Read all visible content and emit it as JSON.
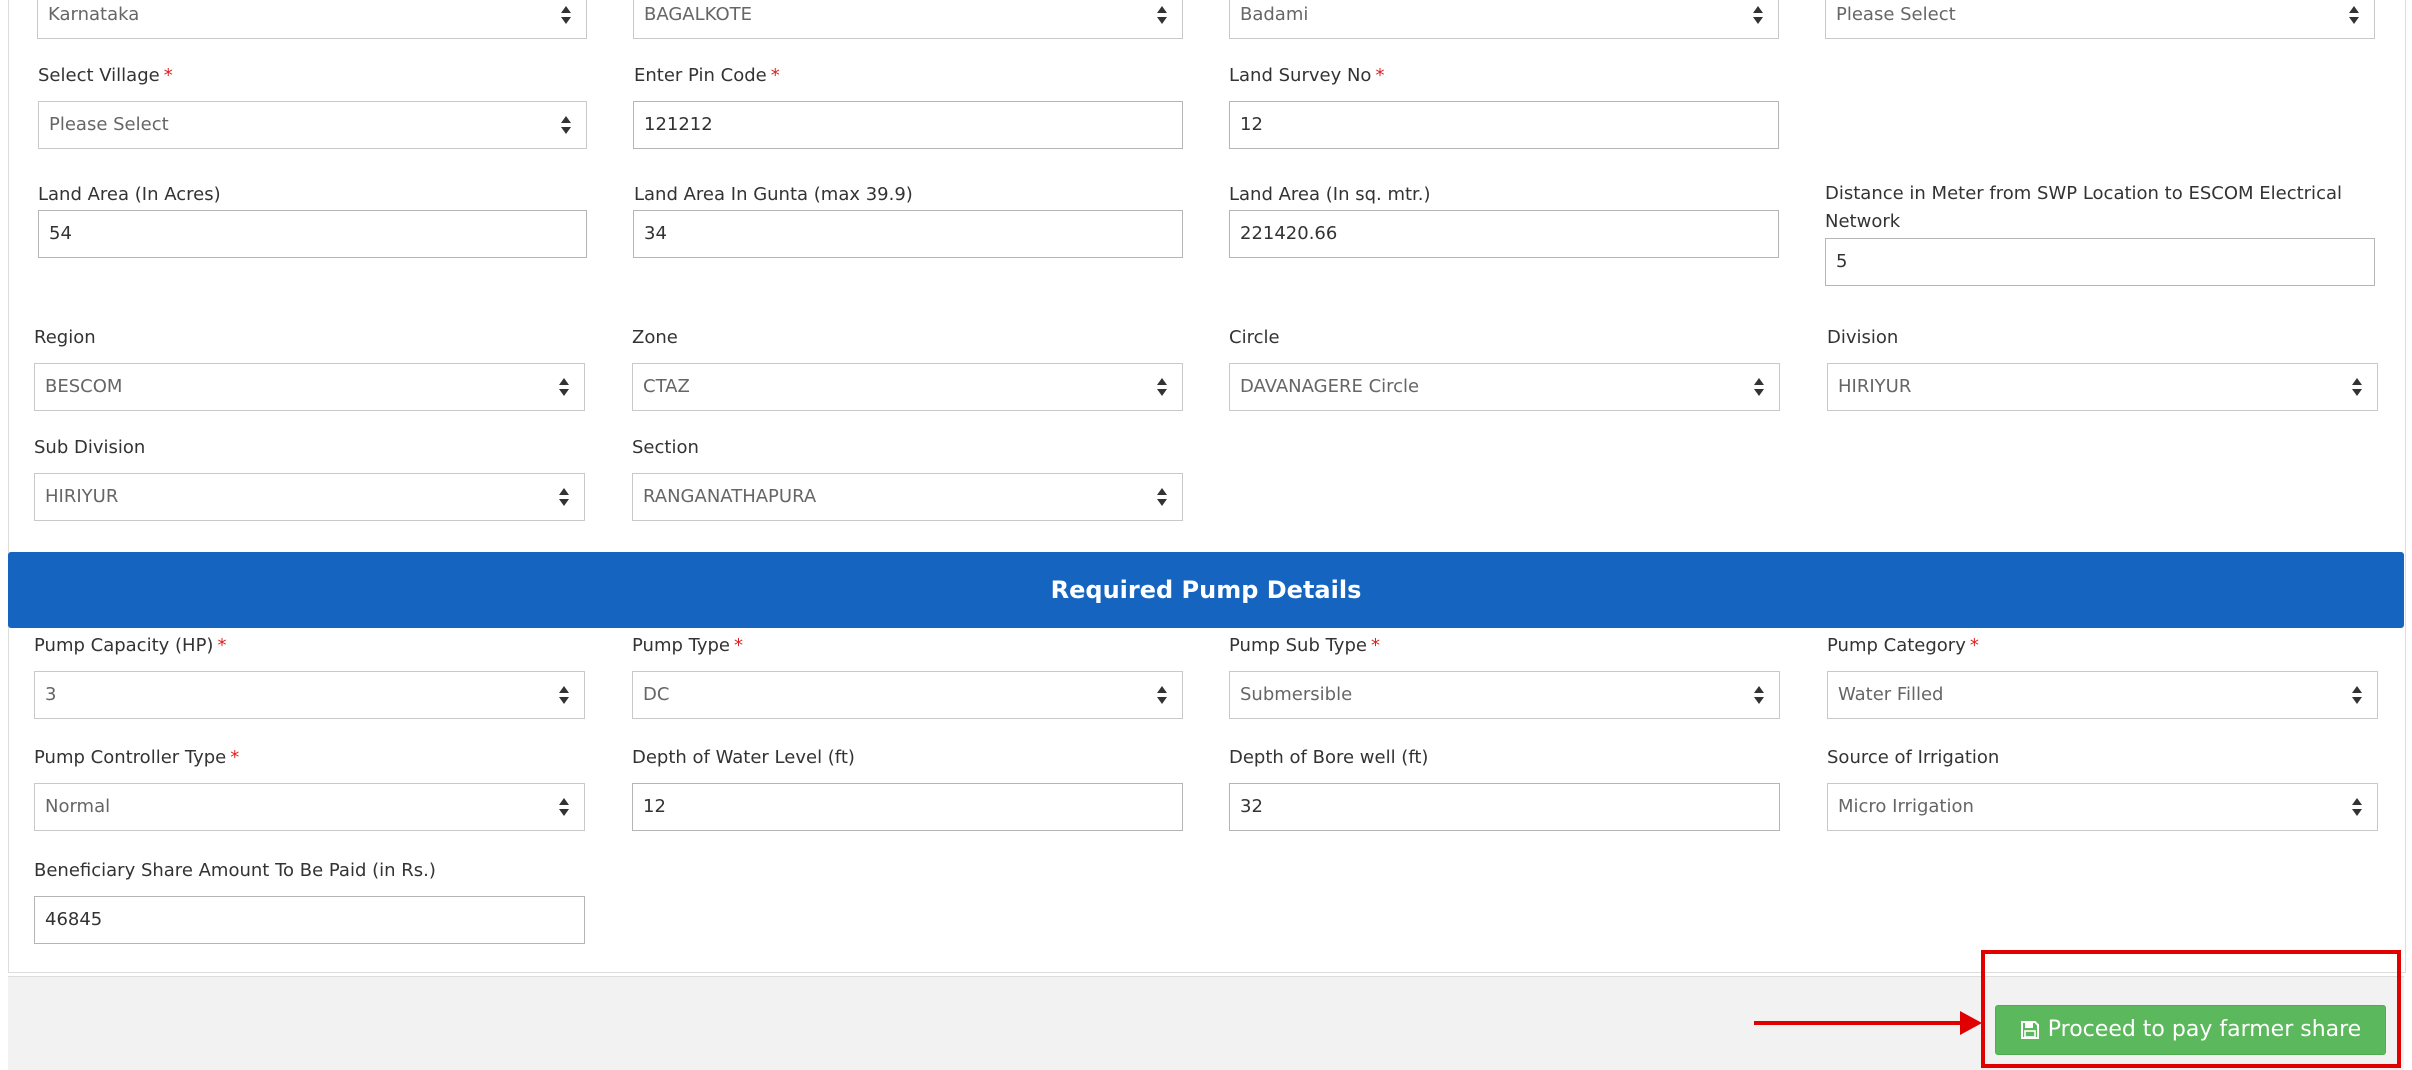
{
  "location_row": {
    "state": "Karnataka",
    "district": "BAGALKOTE",
    "taluk": "Badami",
    "hobli": "Please Select"
  },
  "land_details": {
    "village": {
      "label": "Select Village",
      "value": "Please Select"
    },
    "pincode": {
      "label": "Enter Pin Code",
      "value": "121212"
    },
    "survey_no": {
      "label": "Land Survey No",
      "value": "12"
    },
    "area_acres": {
      "label": "Land Area (In Acres)",
      "value": "54"
    },
    "area_gunta": {
      "label": "Land Area In Gunta (max 39.9)",
      "value": "34"
    },
    "area_sqm": {
      "label": "Land Area (In sq. mtr.)",
      "value": "221420.66"
    },
    "distance": {
      "label": "Distance in Meter from SWP Location to ESCOM Electrical Network",
      "value": "5"
    }
  },
  "escom": {
    "region": {
      "label": "Region",
      "value": "BESCOM"
    },
    "zone": {
      "label": "Zone",
      "value": "CTAZ"
    },
    "circle": {
      "label": "Circle",
      "value": "DAVANAGERE Circle"
    },
    "division": {
      "label": "Division",
      "value": "HIRIYUR"
    },
    "sub_division": {
      "label": "Sub Division",
      "value": "HIRIYUR"
    },
    "section": {
      "label": "Section",
      "value": "RANGANATHAPURA"
    }
  },
  "pump": {
    "heading": "Required Pump Details",
    "capacity": {
      "label": "Pump Capacity (HP)",
      "value": "3"
    },
    "type": {
      "label": "Pump Type",
      "value": "DC"
    },
    "sub_type": {
      "label": "Pump Sub Type",
      "value": "Submersible"
    },
    "category": {
      "label": "Pump Category",
      "value": "Water Filled"
    },
    "controller": {
      "label": "Pump Controller Type",
      "value": "Normal"
    },
    "water_depth": {
      "label": "Depth of Water Level (ft)",
      "value": "12"
    },
    "borewell_depth": {
      "label": "Depth of Bore well (ft)",
      "value": "32"
    },
    "irrigation": {
      "label": "Source of Irrigation",
      "value": "Micro Irrigation"
    },
    "share": {
      "label": "Beneficiary Share Amount To Be Paid (in Rs.)",
      "value": "46845"
    }
  },
  "required_marker": "*",
  "actions": {
    "proceed_label": "Proceed to pay farmer share",
    "icon": "save-icon"
  },
  "colors": {
    "banner": "#1565c0",
    "button": "#5cb85c",
    "highlight": "#e00000",
    "required": "#e02020"
  }
}
